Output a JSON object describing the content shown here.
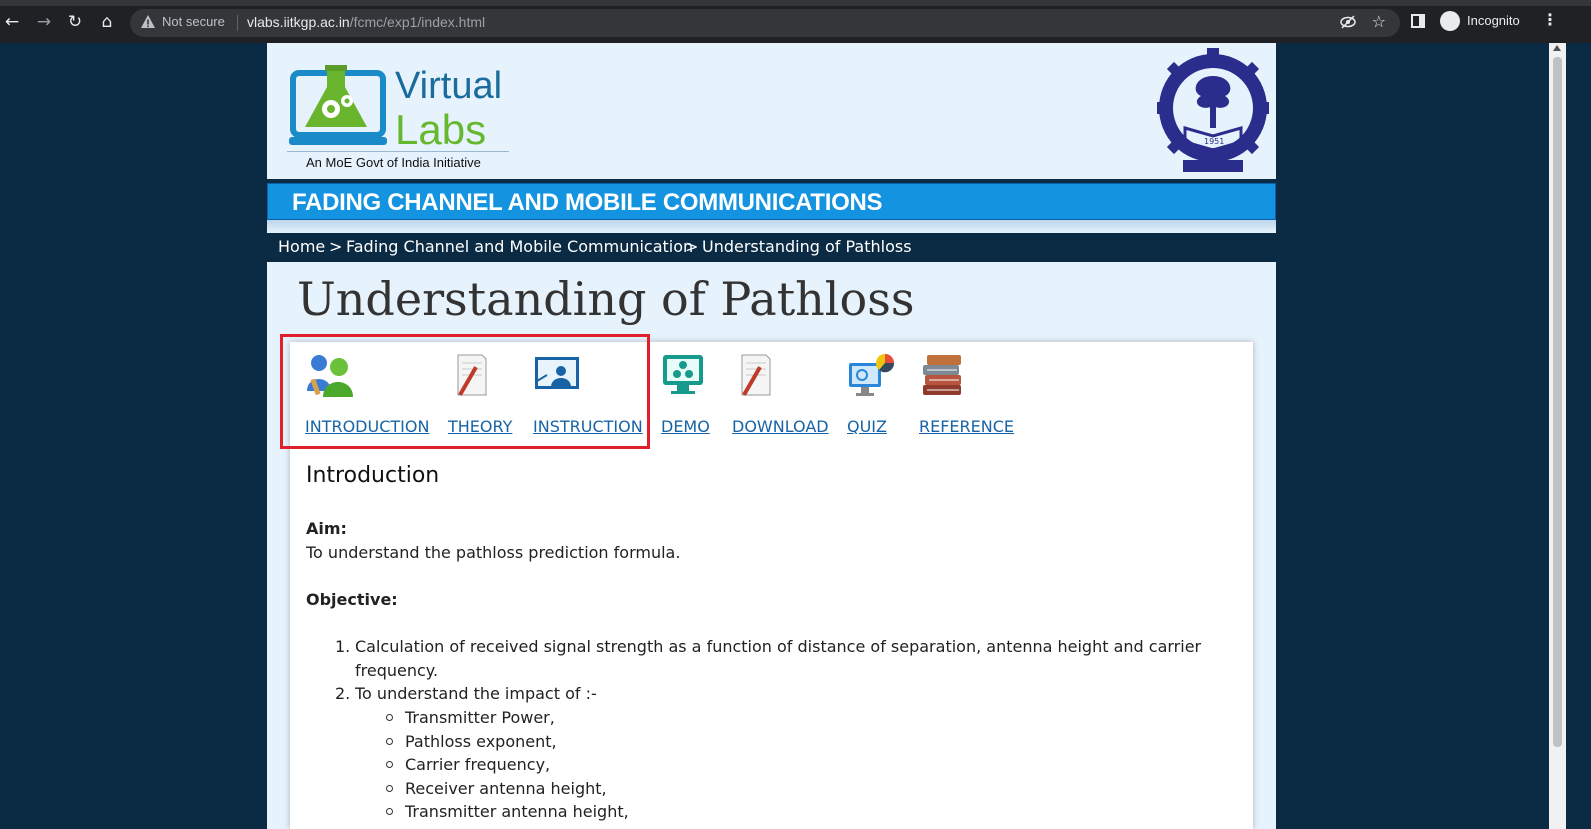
{
  "browser": {
    "not_secure": "Not secure",
    "url_host": "vlabs.iitkgp.ac.in",
    "url_path": "/fcmc/exp1/index.html",
    "incognito": "Incognito"
  },
  "header": {
    "logo_virtual": "Virtual",
    "logo_labs": "Labs",
    "logo_tagline": "An MoE Govt of India Initiative",
    "institute_logo": "IIT Kharagpur emblem (1951)"
  },
  "title_bar": "FADING CHANNEL AND MOBILE COMMUNICATIONS",
  "breadcrumb": {
    "home": "Home",
    "sep1": ">",
    "course": "Fading Channel and Mobile Communication",
    "sep2": ">",
    "current": "Understanding of Pathloss"
  },
  "page_title": "Understanding of Pathloss",
  "tabs": [
    {
      "label": "INTRODUCTION",
      "icon": "users-icon"
    },
    {
      "label": "THEORY",
      "icon": "document-pencil-icon"
    },
    {
      "label": "INSTRUCTION",
      "icon": "presentation-icon"
    },
    {
      "label": "DEMO",
      "icon": "monitor-gears-icon"
    },
    {
      "label": "DOWNLOAD",
      "icon": "document-pencil-icon"
    },
    {
      "label": "QUIZ",
      "icon": "monitor-chart-icon"
    },
    {
      "label": "REFERENCE",
      "icon": "books-icon"
    }
  ],
  "section": {
    "heading": "Introduction",
    "aim_label": "Aim:",
    "aim_text": "To understand the pathloss prediction formula.",
    "objective_label": "Objective:",
    "objectives": [
      {
        "num": "1.",
        "line1": "Calculation of received signal strength as a function of distance of separation, antenna height and carrier",
        "line2": "frequency."
      },
      {
        "num": "2.",
        "line1": "To understand the impact of :-"
      }
    ],
    "impacts": [
      "Transmitter Power,",
      "Pathloss exponent,",
      "Carrier frequency,",
      "Receiver antenna height,",
      "Transmitter antenna height,"
    ]
  },
  "colors": {
    "page_bg": "#0b2a44",
    "header_bg": "#e6f2fc",
    "title_bar": "#1493e0",
    "link": "#1763a6",
    "highlight_box": "#e0212b"
  }
}
